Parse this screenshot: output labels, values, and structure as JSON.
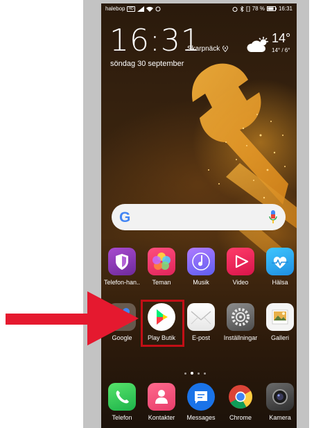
{
  "status_bar": {
    "carrier": "halebop",
    "network": "HD",
    "battery": "78 %",
    "time": "16:31"
  },
  "lock": {
    "clock": "16:31",
    "city": "Skarpnäck",
    "date": "söndag 30 september",
    "temp": "14°",
    "temp_range": "14° / 6°"
  },
  "search": {
    "placeholder": ""
  },
  "apps_row1": [
    {
      "label": "Telefon-han..",
      "icon": "shield-icon"
    },
    {
      "label": "Teman",
      "icon": "themes-icon"
    },
    {
      "label": "Musik",
      "icon": "music-icon"
    },
    {
      "label": "Video",
      "icon": "video-icon"
    },
    {
      "label": "Hälsa",
      "icon": "health-icon"
    }
  ],
  "apps_row2": [
    {
      "label": "Google",
      "icon": "google-folder-icon"
    },
    {
      "label": "Play Butik",
      "icon": "play-store-icon"
    },
    {
      "label": "E-post",
      "icon": "email-icon"
    },
    {
      "label": "Inställningar",
      "icon": "settings-icon"
    },
    {
      "label": "Galleri",
      "icon": "gallery-icon"
    }
  ],
  "dock": [
    {
      "label": "Telefon",
      "icon": "phone-icon"
    },
    {
      "label": "Kontakter",
      "icon": "contacts-icon"
    },
    {
      "label": "Messages",
      "icon": "messages-icon"
    },
    {
      "label": "Chrome",
      "icon": "chrome-icon"
    },
    {
      "label": "Kamera",
      "icon": "camera-icon"
    }
  ],
  "colors": {
    "highlight": "#c20f16",
    "arrow": "#e5192f"
  }
}
